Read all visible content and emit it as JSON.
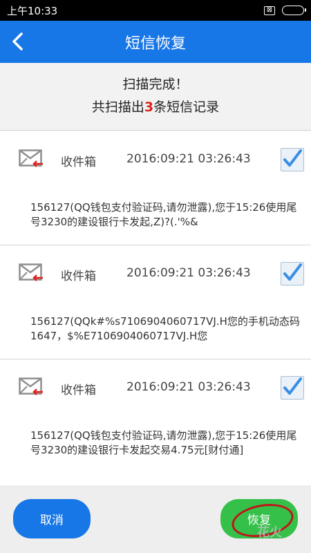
{
  "status_bar": {
    "time": "上午10:33",
    "sim_symbol": "⊠"
  },
  "header": {
    "title": "短信恢复",
    "back_icon": "chevron-left-icon"
  },
  "summary": {
    "title": "扫描完成！",
    "prefix": "共扫描出",
    "count": "3",
    "suffix": "条短信记录",
    "count_color": "#e0201b"
  },
  "messages": [
    {
      "folder": "收件箱",
      "datetime": "2016:09:21   03:26:43",
      "checked": true,
      "body": "156127(QQ钱包支付验证码,请勿泄露),您于15:26使用尾号3230的建设银行卡发起,Z)?(.'%&"
    },
    {
      "folder": "收件箱",
      "datetime": "2016:09:21   03:26:43",
      "checked": true,
      "body": "156127(QQk#%s7106904060717VJ.H您的手机动态码1647，$%E7106904060717VJ.H您"
    },
    {
      "folder": "收件箱",
      "datetime": "2016:09:21   03:26:43",
      "checked": true,
      "body": "156127(QQ钱包支付验证码,请勿泄露),您于15:26使用尾号3230的建设银行卡发起交易4.75元[财付通]"
    }
  ],
  "footer": {
    "cancel_label": "取消",
    "restore_label": "恢复",
    "watermark": "花火"
  },
  "colors": {
    "primary": "#1877e6",
    "confirm": "#35c04a",
    "highlight": "#c0141a"
  }
}
